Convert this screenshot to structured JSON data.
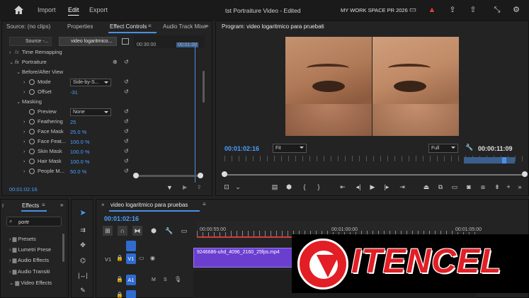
{
  "menu": {
    "home_icon": "home-icon",
    "items": [
      "Import",
      "Edit",
      "Export"
    ],
    "project_title": "tst Portraiture Video - Edited",
    "workspace": "MY WORK SPACE PR 2026"
  },
  "source_panel": {
    "tabs": [
      "Source: (no clips)",
      "Properties",
      "Effect Controls",
      "Audio Track Mixe"
    ],
    "source_chip": "Source -...",
    "clip_chip": "video logaritmico...",
    "ruler": {
      "t1": "00:30:00",
      "t2": "00:01:00"
    },
    "rows": {
      "time_remap": "Time Remapping",
      "fx": "Portraiture",
      "before_after": "Before/After View",
      "mode": {
        "label": "Mode",
        "value": "Side-by-S..."
      },
      "offset": {
        "label": "Offset",
        "value": "-31"
      },
      "masking": "Masking",
      "preview": {
        "label": "Preview",
        "value": "None"
      },
      "feathering": {
        "label": "Feathering",
        "value": "25"
      },
      "face_mask": {
        "label": "Face Mask",
        "value": "25.0 %"
      },
      "face_feat": {
        "label": "Face Feat...",
        "value": "100.0 %"
      },
      "skin_mask": {
        "label": "Skin Mask",
        "value": "100.0 %"
      },
      "hair_mask": {
        "label": "Hair Mask",
        "value": "100.0 %"
      },
      "people_m": {
        "label": "People M...",
        "value": "50.0 %"
      }
    },
    "timecode": "00:01:02:16"
  },
  "program": {
    "title": "Program: video logaritmico para pruebas",
    "timecode": "00:01:02:16",
    "fit": "Fit",
    "quality": "Full",
    "duration": "00:00:11:09"
  },
  "effects": {
    "tab": "Effects",
    "search_value": "portr",
    "items": [
      "Presets",
      "Lumetri Prese",
      "Audio Effects",
      "Audio Transiti",
      "Video Effects"
    ]
  },
  "timeline": {
    "tab": "video logaritmico para pruebas",
    "timecode": "00:01:02:16",
    "ruler": [
      "00:00:55:00",
      "00:01:00:00",
      "00:01:05:00"
    ],
    "tracks": {
      "v1": "V1",
      "v1b": "V1",
      "a1": "A1",
      "m": "M",
      "s": "S"
    },
    "clip_name": "9246686-uhd_4096_2160_25fps.mp4"
  },
  "watermark": {
    "text": "ITENCEL"
  },
  "colors": {
    "accent": "#4a90e2",
    "timecode": "#4b9fff",
    "clip": "#7b4bd6",
    "watermark_red": "#e31e24"
  }
}
